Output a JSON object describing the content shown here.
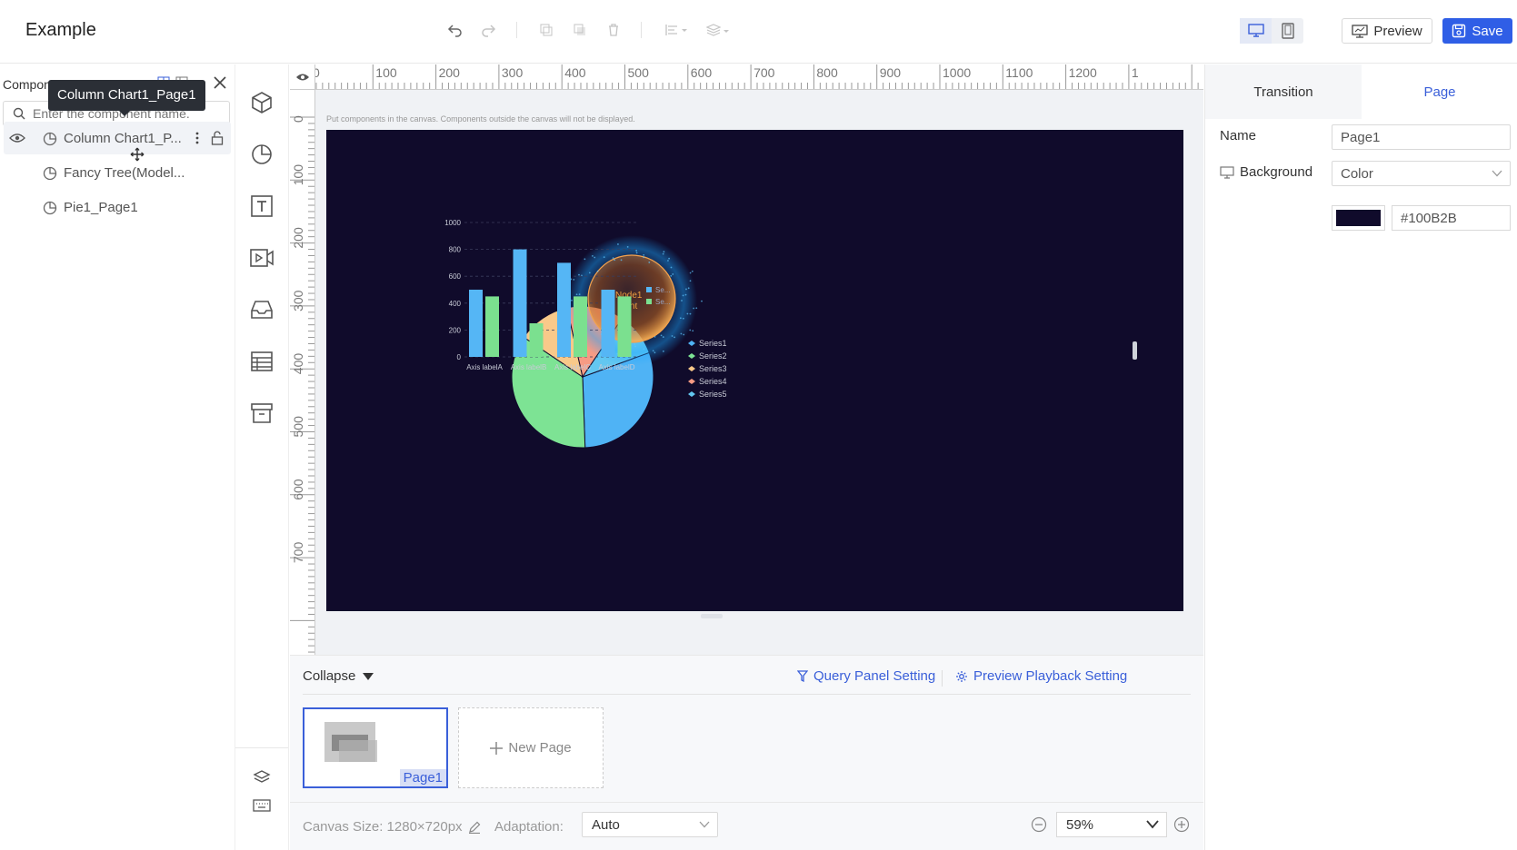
{
  "app": {
    "title": "Example"
  },
  "toolbar": {
    "preview_label": "Preview",
    "save_label": "Save",
    "accent_color": "#2f5ee6"
  },
  "layer_panel": {
    "title": "Component Layer",
    "search_placeholder": "Enter the component name.",
    "tooltip": "Column Chart1_Page1",
    "items": [
      {
        "label": "Column Chart1_P...",
        "selected": true
      },
      {
        "label": "Fancy Tree(Model..."
      },
      {
        "label": "Pie1_Page1"
      }
    ]
  },
  "component_bar": {
    "icons": [
      "cube-icon",
      "pie-chart-icon",
      "text-icon",
      "video-icon",
      "inbox-icon",
      "table-icon",
      "archive-icon"
    ],
    "bottom_icons": [
      "layers-icon",
      "keyboard-icon"
    ]
  },
  "canvas": {
    "hint": "Put components in the canvas. Components outside the canvas will not be displayed.",
    "background": "#100B2B",
    "ruler_h_labels": [
      "0",
      "100",
      "200",
      "300",
      "400",
      "500",
      "600",
      "700",
      "800",
      "900",
      "1000",
      "1100",
      "1200",
      "1"
    ],
    "ruler_v_labels": [
      "0",
      "100",
      "200",
      "300",
      "400",
      "500",
      "600",
      "700"
    ]
  },
  "chart_data": [
    {
      "type": "bar",
      "categories": [
        "Axis labelA",
        "Axis labelB",
        "Axis labelC",
        "Axis labelD"
      ],
      "series": [
        {
          "name": "Series1",
          "values": [
            500,
            800,
            700,
            500
          ]
        },
        {
          "name": "Series2",
          "values": [
            450,
            250,
            450,
            450
          ]
        }
      ],
      "ylim": [
        0,
        1000
      ],
      "yticks": [
        "0",
        "200",
        "400",
        "600",
        "800",
        "1000"
      ],
      "colors": [
        "#55b6f5",
        "#7be08f"
      ]
    },
    {
      "type": "pie",
      "labels": [
        "Series1",
        "Series2",
        "Series3",
        "Series4",
        "Series5"
      ],
      "values": [
        30,
        35,
        12,
        13,
        10
      ],
      "colors": [
        "#4fb3f5",
        "#7de394",
        "#f9c98a",
        "#f79b84",
        "#63c7f0"
      ]
    }
  ],
  "tree_overlay": {
    "node_text": "Node1",
    "sub_text": "ment",
    "legend": [
      "Se...",
      "Se..."
    ]
  },
  "pages_panel": {
    "collapse_label": "Collapse",
    "query_panel_label": "Query Panel Setting",
    "playback_label": "Preview Playback Setting",
    "pages": [
      {
        "label": "Page1"
      }
    ],
    "new_page_label": "New Page"
  },
  "status_bar": {
    "canvas_size": "Canvas Size: 1280×720px",
    "adaptation_label": "Adaptation:",
    "adaptation_value": "Auto",
    "zoom": "59%"
  },
  "props_panel": {
    "tabs": [
      {
        "label": "Transition",
        "active": false
      },
      {
        "label": "Page",
        "active": true
      }
    ],
    "name_label": "Name",
    "name_value": "Page1",
    "background_label": "Background",
    "background_type": "Color",
    "background_color": "#100B2B"
  }
}
